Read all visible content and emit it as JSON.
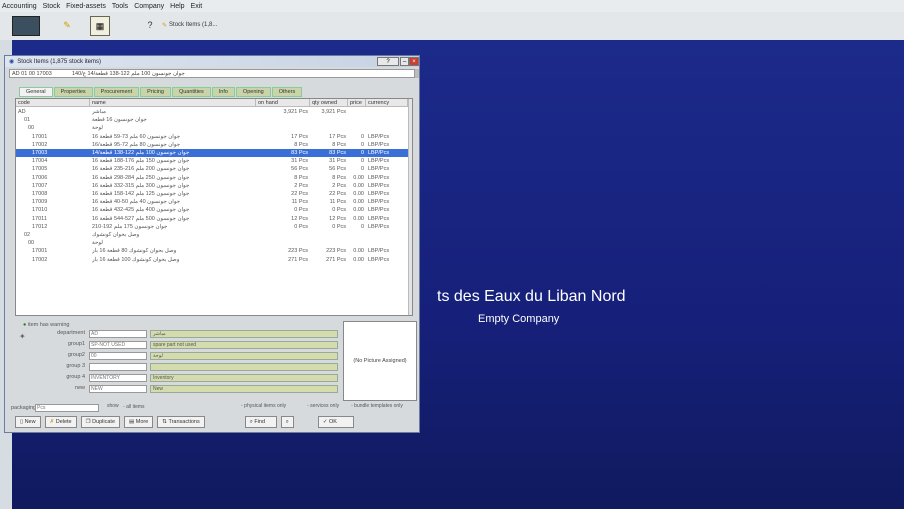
{
  "menu": [
    "Accounting",
    "Stock",
    "Fixed-assets",
    "Tools",
    "Company",
    "Help",
    "Exit"
  ],
  "toolbar": {
    "stock_label": "Stock Items (1,8..."
  },
  "company": {
    "name": "ts des Eaux du Liban Nord",
    "subtitle": "Empty Company"
  },
  "window": {
    "title": "Stock Items (1,875 stock items)",
    "address_code": "AD 01 00 17003",
    "address_value": "جوان جونسون 100 ملم 122-138 قطعة/14 ع/140",
    "tabs": [
      "General",
      "Properties",
      "Procurement",
      "Pricing",
      "Quantities",
      "Info",
      "Opening",
      "Others"
    ],
    "columns": [
      "code",
      "name",
      "on hand",
      "qty owned",
      "price",
      "currency"
    ],
    "rows": [
      {
        "code": "AD",
        "name": "مباشر",
        "onhand": "3,921 Pcs",
        "owned": "3,921 Pcs",
        "price": "",
        "cur": ""
      },
      {
        "code": "01",
        "name": "جوان جونسون 16 قطعة",
        "onhand": "",
        "owned": "",
        "price": "",
        "cur": ""
      },
      {
        "code": "00",
        "name": "لوحة",
        "onhand": "",
        "owned": "",
        "price": "",
        "cur": ""
      },
      {
        "code": "17001",
        "name": "جوان جونسون 60 ملم 73-59 قطعة 16",
        "onhand": "17 Pcs",
        "owned": "17 Pcs",
        "price": "0",
        "cur": "LBP/Pcs"
      },
      {
        "code": "17002",
        "name": "جوان جونسون 80 ملم 72-95 قطعة/16",
        "onhand": "8 Pcs",
        "owned": "8 Pcs",
        "price": "0",
        "cur": "LBP/Pcs"
      },
      {
        "code": "17003",
        "name": "جوان جونسون 100 ملم 122-138 قطعة/14",
        "onhand": "83 Pcs",
        "owned": "83 Pcs",
        "price": "0",
        "cur": "LBP/Pcs"
      },
      {
        "code": "17004",
        "name": "جوان جونسون 150 ملم 176-188 قطعة 16",
        "onhand": "31 Pcs",
        "owned": "31 Pcs",
        "price": "0",
        "cur": "LBP/Pcs"
      },
      {
        "code": "17005",
        "name": "جوان جونسون 200 ملم 216-235 قطعة 16",
        "onhand": "56 Pcs",
        "owned": "56 Pcs",
        "price": "0",
        "cur": "LBP/Pcs"
      },
      {
        "code": "17006",
        "name": "جوان جونسون 250 ملم 284-298 قطعة 16",
        "onhand": "8 Pcs",
        "owned": "8 Pcs",
        "price": "0.00",
        "cur": "LBP/Pcs"
      },
      {
        "code": "17007",
        "name": "جوان جونسون 300 ملم 315-332 قطعة 16",
        "onhand": "2 Pcs",
        "owned": "2 Pcs",
        "price": "0.00",
        "cur": "LBP/Pcs"
      },
      {
        "code": "17008",
        "name": "جوان جونسون 125 ملم 142-158 قطعة 16",
        "onhand": "22 Pcs",
        "owned": "22 Pcs",
        "price": "0.00",
        "cur": "LBP/Pcs"
      },
      {
        "code": "17009",
        "name": "جوان جونسون 40 ملم 50-40 قطعة 16",
        "onhand": "11 Pcs",
        "owned": "11 Pcs",
        "price": "0.00",
        "cur": "LBP/Pcs"
      },
      {
        "code": "17010",
        "name": "جوان جونسون 400 ملم 425-432 قطعة 16",
        "onhand": "0 Pcs",
        "owned": "0 Pcs",
        "price": "0.00",
        "cur": "LBP/Pcs"
      },
      {
        "code": "17011",
        "name": "جوان جونسون 500 ملم 527-544 قطعة 16",
        "onhand": "12 Pcs",
        "owned": "12 Pcs",
        "price": "0.00",
        "cur": "LBP/Pcs"
      },
      {
        "code": "17012",
        "name": "جوان جونسون 175 ملم 192-210",
        "onhand": "0 Pcs",
        "owned": "0 Pcs",
        "price": "0",
        "cur": "LBP/Pcs"
      },
      {
        "code": "02",
        "name": "وصل بحوان كونشوك",
        "onhand": "",
        "owned": "",
        "price": "",
        "cur": ""
      },
      {
        "code": "00",
        "name": "لوحة",
        "onhand": "",
        "owned": "",
        "price": "",
        "cur": ""
      },
      {
        "code": "17001",
        "name": "وصل بحوان كونشوك 80 قطعة 16 بار",
        "onhand": "223 Pcs",
        "owned": "223 Pcs",
        "price": "0.00",
        "cur": "LBP/Pcs"
      },
      {
        "code": "17002",
        "name": "وصل بحوان كونشوك 100 قطعة 16 بار",
        "onhand": "271 Pcs",
        "owned": "271 Pcs",
        "price": "0.00",
        "cur": "LBP/Pcs"
      }
    ],
    "warning": "item has warning",
    "fields": [
      {
        "label": "department",
        "value": "AD",
        "desc": "مباشر"
      },
      {
        "label": "group1",
        "value": "SP-NOT USED",
        "desc": "spare part not used"
      },
      {
        "label": "group2",
        "value": "00",
        "desc": "لوحة"
      },
      {
        "label": "group 3",
        "value": "",
        "desc": ""
      },
      {
        "label": "group 4",
        "value": "INVENTORY",
        "desc": "Inventory"
      },
      {
        "label": "new",
        "value": "NEW",
        "desc": "New"
      }
    ],
    "no_picture": "(No Picture Assigned)",
    "packaging_label": "packaging",
    "packaging_value": "Pcs",
    "show_label": "show",
    "show_value": "all items",
    "filters": [
      "physical items only",
      "services only",
      "bundle templates only"
    ],
    "buttons": [
      "New",
      "Delete",
      "Duplicate",
      "More",
      "Transactions",
      "Find",
      "OK"
    ]
  }
}
